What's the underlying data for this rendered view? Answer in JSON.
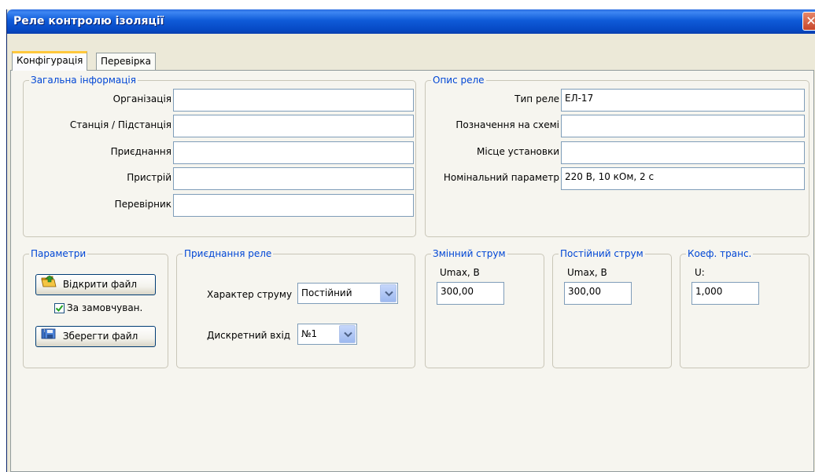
{
  "window": {
    "title": "Реле контролю ізоляції",
    "close_glyph": "✕"
  },
  "tabs": [
    {
      "label": "Конфігурація",
      "active": true
    },
    {
      "label": "Перевірка",
      "active": false
    }
  ],
  "general_info": {
    "title": "Загальна інформація",
    "fields": [
      {
        "label": "Організація",
        "value": ""
      },
      {
        "label": "Станція / Підстанція",
        "value": ""
      },
      {
        "label": "Приєднання",
        "value": ""
      },
      {
        "label": "Пристрій",
        "value": ""
      },
      {
        "label": "Перевірник",
        "value": ""
      }
    ]
  },
  "relay_desc": {
    "title": "Опис реле",
    "fields": [
      {
        "label": "Тип реле",
        "value": "ЕЛ-17"
      },
      {
        "label": "Позначення на схемі",
        "value": ""
      },
      {
        "label": "Місце установки",
        "value": ""
      },
      {
        "label": "Номінальний параметр",
        "value": "220 В, 10 кОм, 2 с"
      }
    ]
  },
  "parameters": {
    "title": "Параметри",
    "open_file_label": "Відкрити файл",
    "default_label": "За замовчуван.",
    "default_checked": true,
    "save_file_label": "Зберегти файл"
  },
  "relay_connection": {
    "title": "Приєднання реле",
    "current_type_label": "Характер струму",
    "current_type_value": "Постійний",
    "discrete_input_label": "Дискретний вхід",
    "discrete_input_value": "№1"
  },
  "ac": {
    "title": "Змінний струм",
    "label": "Umax, В",
    "value": "300,00"
  },
  "dc": {
    "title": "Постійний струм",
    "label": "Umax, В",
    "value": "300,00"
  },
  "coef": {
    "title": "Коеф. транс.",
    "label": "U:",
    "value": "1,000"
  },
  "icons": {
    "close": "close-icon",
    "open": "folder-open-icon",
    "save": "save-disk-icon",
    "dropdown": "chevron-down-icon",
    "check": "checkmark-icon"
  },
  "colors": {
    "titlebar": "#0f5bd8",
    "group_label": "#0046d5",
    "active_tab_accent": "#ffc83c",
    "close_button": "#c7452a"
  }
}
